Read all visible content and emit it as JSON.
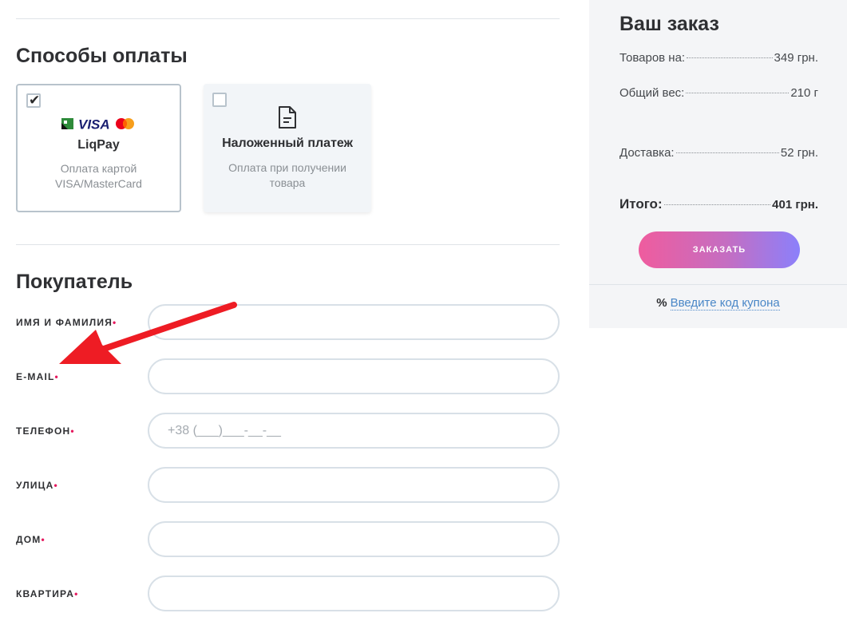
{
  "payment": {
    "title": "Способы оплаты",
    "options": [
      {
        "title": "LiqPay",
        "description": "Оплата картой VISA/MasterCard",
        "checked": true,
        "logos": [
          "liqpay-icon",
          "visa-icon",
          "mastercard-icon"
        ],
        "visa_text": "VISA"
      },
      {
        "title": "Наложенный платеж",
        "description": "Оплата при получении товара",
        "checked": false,
        "icon": "document-icon"
      }
    ]
  },
  "buyer": {
    "title": "Покупатель",
    "required_mark": "•",
    "fields": [
      {
        "label": "Имя и фамилия",
        "value": "",
        "placeholder": ""
      },
      {
        "label": "E-mail",
        "value": "",
        "placeholder": ""
      },
      {
        "label": "Телефон",
        "value": "",
        "placeholder": "+38 (___)___-__-__"
      },
      {
        "label": "Улица",
        "value": "",
        "placeholder": ""
      },
      {
        "label": "Дом",
        "value": "",
        "placeholder": ""
      },
      {
        "label": "Квартира",
        "value": "",
        "placeholder": ""
      }
    ]
  },
  "order": {
    "title": "Ваш заказ",
    "rows": [
      {
        "label": "Товаров на:",
        "value": "349 грн."
      },
      {
        "label": "Общий вес:",
        "value": "210 г"
      },
      {
        "label": "Доставка:",
        "value": "52 грн."
      }
    ],
    "total": {
      "label": "Итого:",
      "value": "401 грн."
    },
    "button_label": "ЗАКАЗАТЬ",
    "coupon": {
      "symbol": "%",
      "link_text": "Введите код купона"
    }
  },
  "annotation": {
    "icon": "red-arrow-icon",
    "color": "#ee1c24"
  },
  "colors": {
    "accent_start": "#ef5c9e",
    "accent_end": "#8b80fb",
    "required": "#e5195e",
    "link": "#4a87c7"
  }
}
